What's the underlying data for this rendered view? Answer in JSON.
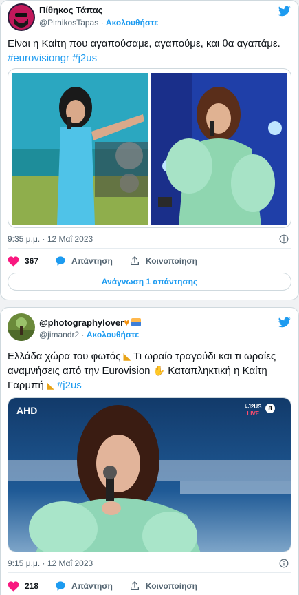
{
  "tweet1": {
    "author_name": "Πίθηκος Τάπας",
    "handle": "@PithikosTapas",
    "separator": " · ",
    "follow": "Ακολουθήστε",
    "text_main": "Είναι η Καίτη που αγαπούσαμε, αγαπούμε, και θα αγαπάμε. ",
    "tag1": "#eurovisiongr",
    "tag2": "#j2us",
    "time": "9:35 μ.μ. · 12 Μαΐ 2023",
    "likes": "367",
    "reply": "Απάντηση",
    "share": "Κοινοποίηση",
    "read_replies": "Ανάγνωση 1 απάντησης"
  },
  "tweet2": {
    "author_name": "@photographylover",
    "handle": "@jimandr2",
    "separator": " · ",
    "follow": "Ακολουθήστε",
    "text_main": "Ελλάδα χώρα του φωτός ",
    "text_part2": " Τι ωραίο τραγούδι και τι ωραίες αναμνήσεις από την Eurovision ",
    "text_part3": " Καταπληκτική η Καίτη Γαρμπή ",
    "tag1": "#j2us",
    "time": "9:15 μ.μ. · 12 Μαΐ 2023",
    "likes": "218",
    "reply": "Απάντηση",
    "share": "Κοινοποίηση",
    "tv_logo": "AHD",
    "tv_badge_top": "#J2US",
    "tv_badge_bottom": "LIVE",
    "tv_rating": "8"
  },
  "colors": {
    "accent": "#1d9bf0",
    "like": "#f91880",
    "text": "#0f1419",
    "muted": "#536471"
  },
  "icons": [
    "twitter-bird-icon",
    "info-icon",
    "heart-icon",
    "comment-icon",
    "share-icon",
    "party-emoji-icon",
    "clap-emoji-icon",
    "heart-orange-emoji-icon",
    "sunrise-emoji-icon"
  ]
}
